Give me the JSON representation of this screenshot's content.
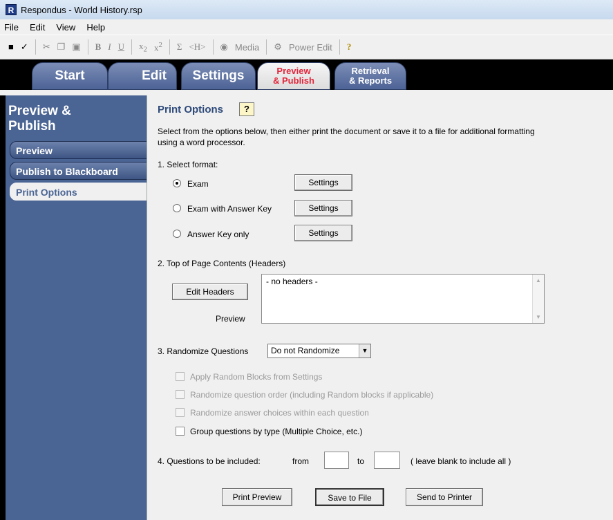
{
  "window": {
    "title": "Respondus - World History.rsp",
    "app_icon": "R"
  },
  "menu": [
    "File",
    "Edit",
    "View",
    "Help"
  ],
  "toolbar": {
    "media_label": "Media",
    "power_edit_label": "Power Edit"
  },
  "tabs": {
    "start": "Start",
    "edit": "Edit",
    "settings": "Settings",
    "preview_publish_1": "Preview",
    "preview_publish_2": "& Publish",
    "retrieval_1": "Retrieval",
    "retrieval_2": "& Reports"
  },
  "sidebar": {
    "title_1": "Preview &",
    "title_2": "Publish",
    "items": [
      "Preview",
      "Publish to Blackboard",
      "Print Options"
    ]
  },
  "main": {
    "heading": "Print Options",
    "help_icon": "?",
    "intro_1": "Select from the options below, then either print the document or save it to a file for additional formatting",
    "intro_2": "using a word processor.",
    "step1": "1.  Select format:",
    "formats": [
      {
        "label": "Exam",
        "selected": true
      },
      {
        "label": "Exam with Answer Key",
        "selected": false
      },
      {
        "label": "Answer Key only",
        "selected": false
      }
    ],
    "settings_button": "Settings",
    "step2": "2.  Top of Page Contents (Headers)",
    "edit_headers": "Edit Headers",
    "preview_label": "Preview",
    "headers_value": "- no headers -",
    "step3": "3.  Randomize Questions",
    "randomize_value": "Do not Randomize",
    "options": [
      {
        "label": "Apply Random Blocks from Settings",
        "enabled": false,
        "checked": false
      },
      {
        "label": "Randomize question order (including Random blocks if applicable)",
        "enabled": false,
        "checked": false
      },
      {
        "label": "Randomize answer choices within each question",
        "enabled": false,
        "checked": false
      },
      {
        "label": "Group questions by type (Multiple Choice, etc.)",
        "enabled": true,
        "checked": false
      }
    ],
    "step4": "4.  Questions to be included:",
    "from_label": "from",
    "to_label": "to",
    "from_value": "",
    "to_value": "",
    "range_hint": "( leave blank to include all )",
    "print_preview": "Print Preview",
    "save_to_file": "Save to File",
    "send_to_printer": "Send to Printer"
  }
}
